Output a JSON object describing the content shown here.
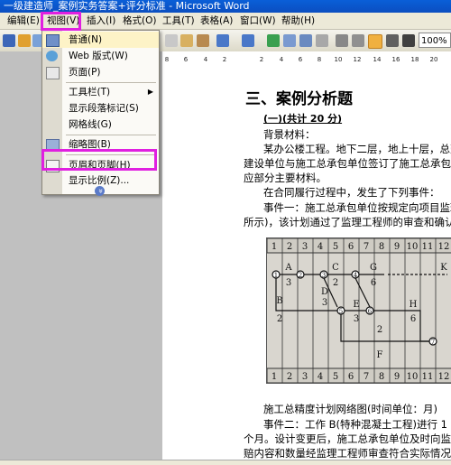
{
  "window": {
    "title": "一级建造师_案例实务答案+评分标准 - Microsoft Word"
  },
  "menubar": {
    "items": [
      "编辑(E)",
      "视图(V)",
      "插入(I)",
      "格式(O)",
      "工具(T)",
      "表格(A)",
      "窗口(W)",
      "帮助(H)"
    ]
  },
  "toolbar": {
    "zoom": "100%"
  },
  "view_menu": {
    "items": [
      "普通(N)",
      "Web 版式(W)",
      "页面(P)",
      "工具栏(T)",
      "显示段落标记(S)",
      "网格线(G)",
      "缩略图(B)",
      "页眉和页脚(H)",
      "显示比例(Z)..."
    ],
    "expand_glyph": "»"
  },
  "ruler": {
    "ticks": [
      "8",
      "6",
      "4",
      "2",
      "2",
      "4",
      "6",
      "8",
      "10",
      "12",
      "14",
      "16",
      "18",
      "20"
    ]
  },
  "document": {
    "heading": "三、案例分析题",
    "subheading": "(一)(共计 20 分)",
    "lines": [
      "背景材料：",
      "某办公楼工程。地下二层，地上十层，总建筑",
      "建设单位与施工总承包单位签订了施工总承包合",
      "应部分主要材料。",
      "在合同履行过程中，发生了下列事件：",
      "事件一：施工总承包单位按规定向项目监理",
      "所示)，该计划通过了监理工程师的审查和确认。"
    ],
    "network_diagram": {
      "header_numbers": [
        "1",
        "2",
        "3",
        "4",
        "5",
        "6",
        "7",
        "8",
        "9",
        "10",
        "11",
        "12"
      ],
      "activities": [
        "A",
        "B",
        "C",
        "D",
        "E",
        "F",
        "G",
        "H",
        "K"
      ],
      "durations": [
        "3",
        "2",
        "2",
        "3",
        "3",
        "2",
        "6",
        "6"
      ],
      "nodes": [
        "1",
        "2",
        "3",
        "4",
        "5",
        "6",
        "7"
      ]
    },
    "caption": "施工总精度计划网络图(时间单位：月)",
    "after_lines": [
      "事件二：工作 B(特种混凝土工程)进行 1 个月",
      "个月。设计变更后，施工总承包单位及时向监理工",
      "赔内容和数量经监理工程师审查符合实际情况。"
    ]
  },
  "colors": {
    "highlight": "#e020e0",
    "titlebar": "#0a5fd8"
  }
}
